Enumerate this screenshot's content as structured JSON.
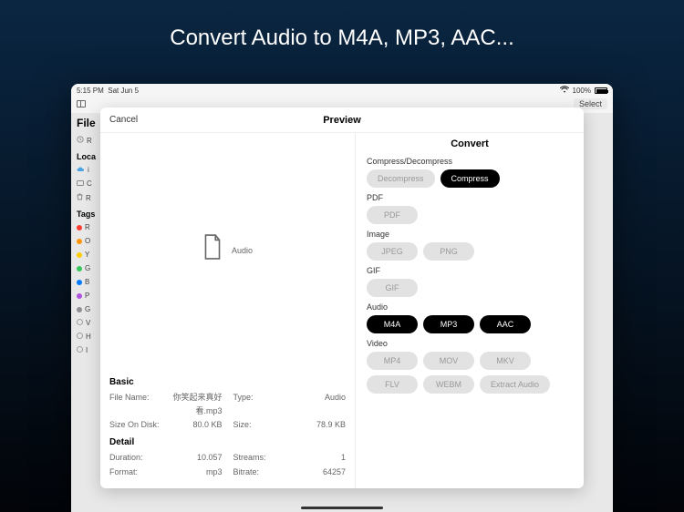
{
  "promo": {
    "title": "Convert Audio to M4A,  MP3, AAC..."
  },
  "statusbar": {
    "time": "5:15 PM",
    "date": "Sat Jun 5",
    "battery_pct": "100%"
  },
  "back": {
    "select_label": "Select",
    "files_title": "File",
    "recents_letter": "R",
    "locations_label": "Loca",
    "loc_cloud": "i",
    "loc_ipad": "C",
    "loc_trash": "R",
    "tags_label": "Tags",
    "tag_letters": [
      "R",
      "O",
      "Y",
      "G",
      "B",
      "P",
      "G"
    ],
    "circle_rows": [
      "V",
      "H",
      "I"
    ]
  },
  "modal": {
    "cancel": "Cancel",
    "title": "Preview",
    "preview_label": "Audio",
    "basic_label": "Basic",
    "detail_label": "Detail",
    "basic": {
      "filename_k": "File Name:",
      "filename_v": "你笑起来真好看.mp3",
      "type_k": "Type:",
      "type_v": "Audio",
      "sizedisk_k": "Size On Disk:",
      "sizedisk_v": "80.0 KB",
      "size_k": "Size:",
      "size_v": "78.9 KB"
    },
    "detail": {
      "duration_k": "Duration:",
      "duration_v": "10.057",
      "streams_k": "Streams:",
      "streams_v": "1",
      "format_k": "Format:",
      "format_v": "mp3",
      "bitrate_k": "Bitrate:",
      "bitrate_v": "64257"
    }
  },
  "convert": {
    "title": "Convert",
    "compress_section": "Compress/Decompress",
    "decompress": "Decompress",
    "compress": "Compress",
    "pdf_section": "PDF",
    "pdf": "PDF",
    "image_section": "Image",
    "jpeg": "JPEG",
    "png": "PNG",
    "gif_section": "GIF",
    "gif": "GIF",
    "audio_section": "Audio",
    "m4a": "M4A",
    "mp3": "MP3",
    "aac": "AAC",
    "video_section": "Video",
    "mp4": "MP4",
    "mov": "MOV",
    "mkv": "MKV",
    "flv": "FLV",
    "webm": "WEBM",
    "extract": "Extract Audio"
  },
  "tag_colors": [
    "#ff3b30",
    "#ff9500",
    "#ffcc00",
    "#34c759",
    "#007aff",
    "#af52de",
    "#8e8e93"
  ]
}
